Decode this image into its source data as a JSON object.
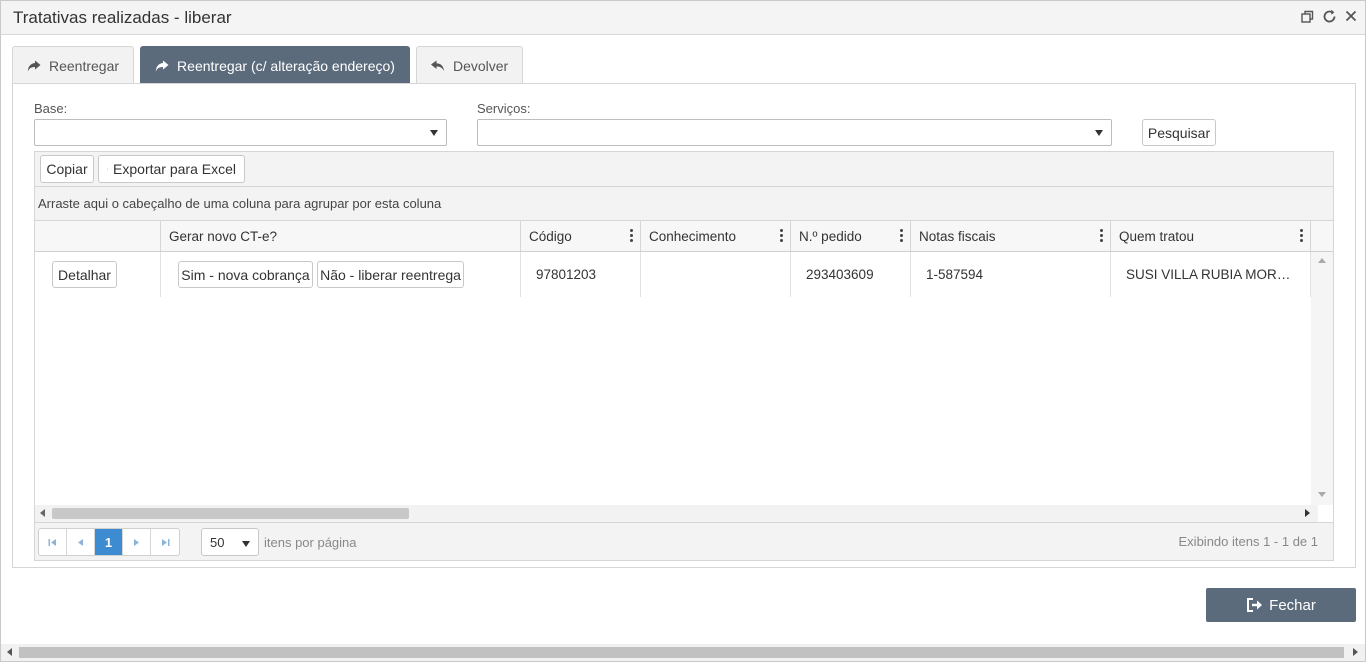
{
  "window": {
    "title": "Tratativas realizadas - liberar",
    "icons": [
      "restore-icon",
      "refresh-icon",
      "close-icon"
    ]
  },
  "tabs": [
    {
      "label": "Reentregar",
      "icon": "share-arrow-icon",
      "active": false
    },
    {
      "label": "Reentregar (c/ alteração endereço)",
      "icon": "share-arrow-icon",
      "active": true
    },
    {
      "label": "Devolver",
      "icon": "undo-arrow-icon",
      "active": false
    }
  ],
  "filters": {
    "base_label": "Base:",
    "base_value": "",
    "servicos_label": "Serviços:",
    "servicos_value": "",
    "search_label": "Pesquisar"
  },
  "grid": {
    "toolbar": {
      "copy_label": "Copiar",
      "export_label": "Exportar para Excel"
    },
    "grouping_hint": "Arraste aqui o cabeçalho de uma coluna para agrupar por esta coluna",
    "columns": [
      "",
      "Gerar novo CT-e?",
      "Código",
      "Conhecimento",
      "N.º pedido",
      "Notas fiscais",
      "Quem tratou"
    ],
    "rows": [
      {
        "detail_label": "Detalhar",
        "yes_label": "Sim - nova cobrança",
        "no_label": "Não - liberar reentrega",
        "codigo": "97801203",
        "conhecimento": "",
        "pedido": "293403609",
        "notas": "1-587594",
        "quem": "SUSI VILLA RUBIA MOREIRA"
      }
    ],
    "pager": {
      "current_page": "1",
      "page_size": "50",
      "per_page_label": "itens por página",
      "info": "Exibindo itens 1 - 1 de 1"
    }
  },
  "footer": {
    "close_label": "Fechar"
  },
  "colors": {
    "accent": "#5b6b7c",
    "pager_active": "#3d8bd0"
  }
}
